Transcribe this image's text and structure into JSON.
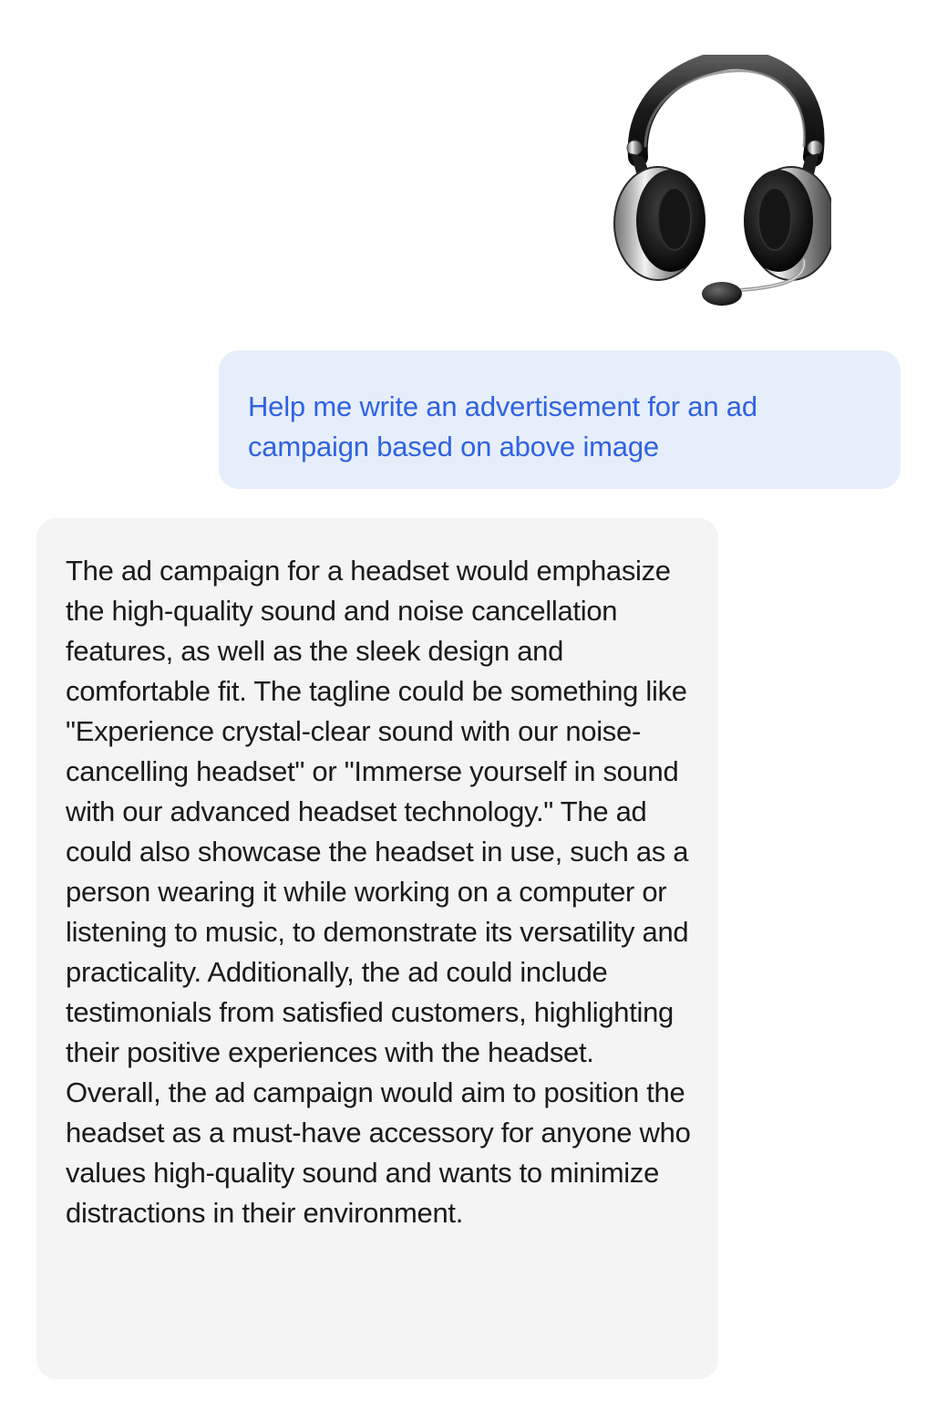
{
  "attached_image": {
    "icon": "headset-icon"
  },
  "user_message": {
    "text": "Help me write an advertisement for an ad campaign based on above image"
  },
  "assistant_message": {
    "text": "The ad campaign for a headset would emphasize the high-quality sound and noise cancellation features, as well as the sleek design and comfortable fit. The tagline could be something like \"Experience crystal-clear sound with our noise-cancelling headset\" or \"Immerse yourself in sound with our advanced headset technology.\" The ad could also showcase the headset in use, such as a person wearing it while working on a computer or listening to music, to demonstrate its versatility and practicality. Additionally, the ad could include testimonials from satisfied customers, highlighting their positive experiences with the headset. Overall, the ad campaign would aim to position the headset as a must-have accessory for anyone who values high-quality sound and wants to minimize distractions in their environment."
  },
  "colors": {
    "user_bubble_bg": "#e7eefb",
    "user_text": "#2f63e3",
    "assistant_bubble_bg": "#f4f4f4",
    "assistant_text": "#1a1a1a"
  }
}
